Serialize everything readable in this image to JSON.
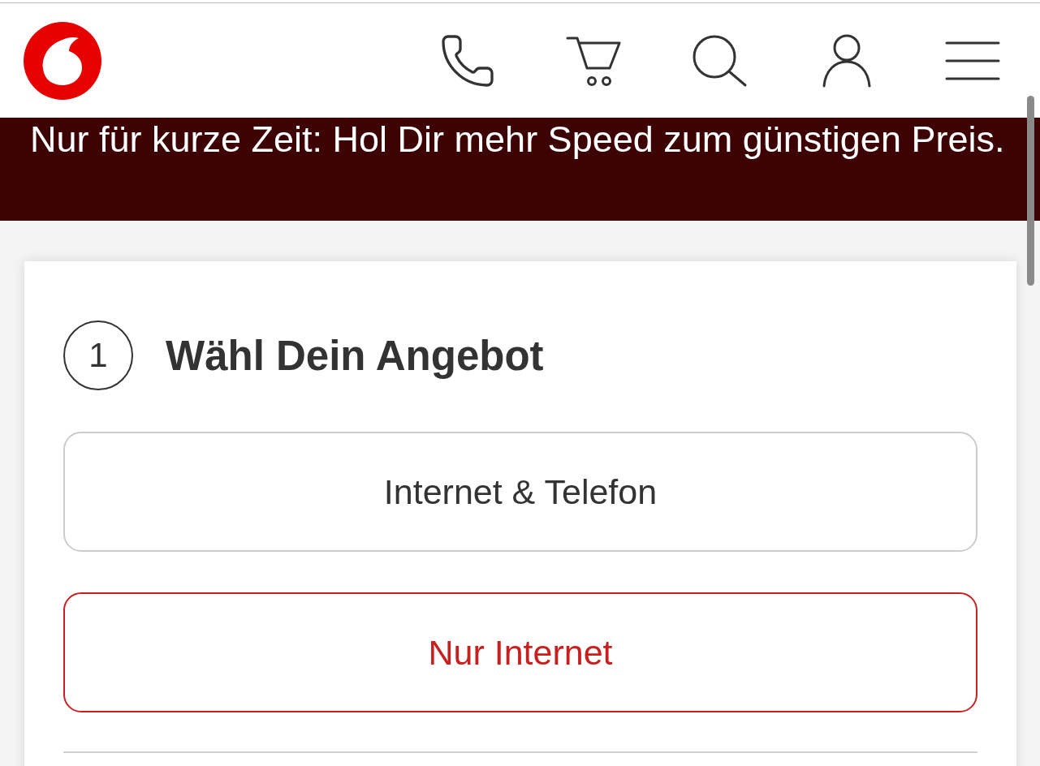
{
  "banner": {
    "text": "Nur für kurze Zeit: Hol Dir mehr Speed zum günstigen Preis."
  },
  "step": {
    "number": "1",
    "title": "Wähl Dein Angebot"
  },
  "options": [
    {
      "label": "Internet & Telefon",
      "selected": false
    },
    {
      "label": "Nur Internet",
      "selected": true
    }
  ]
}
